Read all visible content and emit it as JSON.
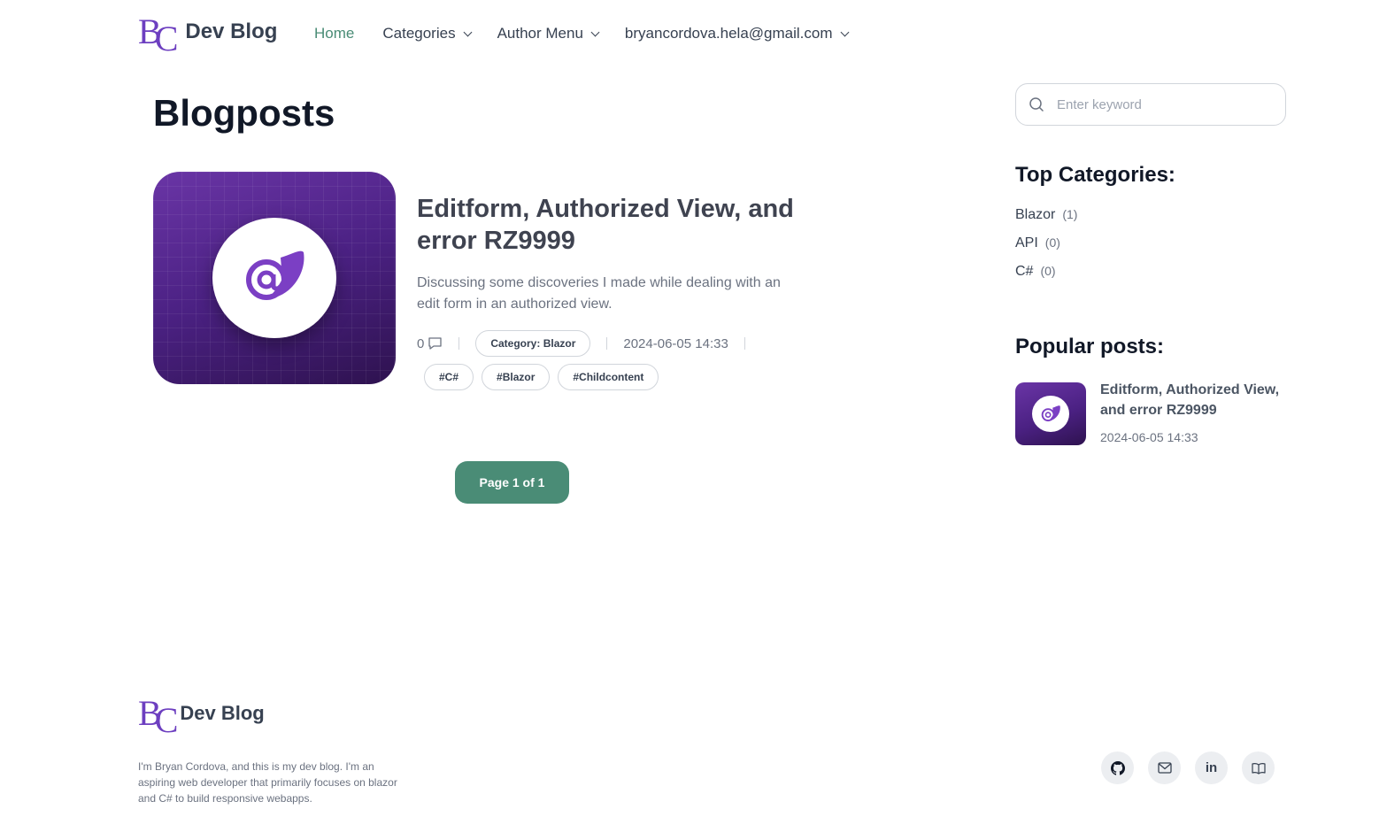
{
  "header": {
    "logo_monogram": [
      "B",
      "C"
    ],
    "site_name": "Dev Blog",
    "nav": [
      {
        "label": "Home"
      },
      {
        "label": "Categories"
      },
      {
        "label": "Author Menu"
      },
      {
        "label": "bryancordova.hela@gmail.com"
      }
    ]
  },
  "main": {
    "title": "Blogposts",
    "post": {
      "title": "Editform, Authorized View, and error RZ9999",
      "excerpt": "Discussing some discoveries I made while dealing with an edit form in an authorized view.",
      "comment_count": "0",
      "category": "Category: Blazor",
      "date": "2024-06-05 14:33",
      "tags": [
        "#C#",
        "#Blazor",
        "#Childcontent"
      ]
    },
    "pagination": "Page 1 of 1"
  },
  "sidebar": {
    "search_placeholder": "Enter keyword",
    "top_categories_title": "Top Categories:",
    "categories": [
      {
        "name": "Blazor",
        "count": "(1)"
      },
      {
        "name": "API",
        "count": "(0)"
      },
      {
        "name": "C#",
        "count": "(0)"
      }
    ],
    "popular_title": "Popular posts:",
    "popular": [
      {
        "title": "Editform, Authorized View, and error RZ9999",
        "date": "2024-06-05 14:33"
      }
    ]
  },
  "footer": {
    "logo_monogram": [
      "B",
      "C"
    ],
    "site_name": "Dev Blog",
    "about": "I'm Bryan Cordova, and this is my dev blog. I'm an aspiring web developer that primarily focuses on blazor and C# to build responsive webapps.",
    "linkedin_label": "in",
    "social_icons": [
      "github-icon",
      "mail-icon",
      "linkedin-icon",
      "book-icon"
    ]
  },
  "colors": {
    "accent": "#4a8c76",
    "brand_purple": "#6d3fc0",
    "thumb_purple": "#4b2183"
  }
}
